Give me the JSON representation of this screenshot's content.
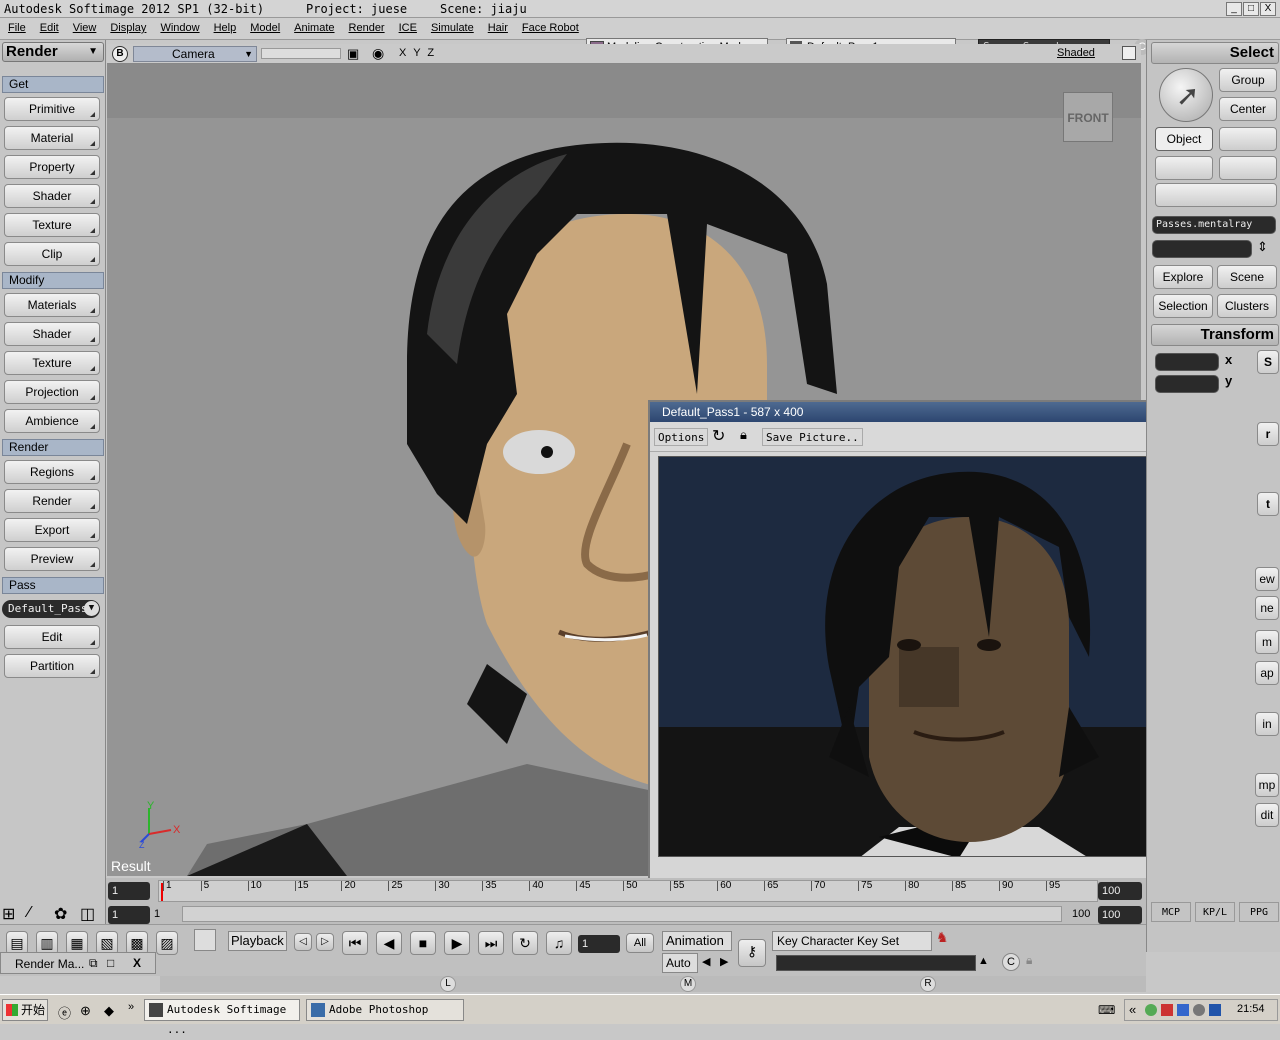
{
  "title_bar": {
    "app_title": "Autodesk Softimage 2012 SP1 (32-bit)",
    "project": "Project: juese",
    "scene": "Scene: jiaju",
    "min": "_",
    "max": "□",
    "close": "X"
  },
  "menu": {
    "items": [
      "File",
      "Edit",
      "View",
      "Display",
      "Window",
      "Help",
      "Model",
      "Animate",
      "Render",
      "ICE",
      "Simulate",
      "Hair",
      "Face Robot"
    ],
    "mode_dropdown": "Modeling Construction Mode",
    "pass_dropdown": "Default_Pass1",
    "search_placeholder": "Scene Search"
  },
  "left_panel": {
    "title": "Render",
    "sections": [
      {
        "header": "Get",
        "buttons": [
          "Primitive",
          "Material",
          "Property",
          "Shader",
          "Texture",
          "Clip"
        ]
      },
      {
        "header": "Modify",
        "buttons": [
          "Materials",
          "Shader",
          "Texture",
          "Projection",
          "Ambience"
        ]
      },
      {
        "header": "Render",
        "buttons": [
          "Regions",
          "Render",
          "Export",
          "Preview"
        ]
      },
      {
        "header": "Pass",
        "buttons": [
          "Edit",
          "Partition"
        ]
      }
    ],
    "pass_select": "Default_Pass"
  },
  "viewport": {
    "badge": "B",
    "camera": "Camera",
    "axes": "X Y Z",
    "shading": "Shaded",
    "front_label": "FRONT",
    "result_label": "Result",
    "axis_y": "Y",
    "axis_x": "X",
    "axis_z": "Z"
  },
  "render_window": {
    "title": "Default_Pass1 -  587 x 400",
    "options": "Options",
    "save": "Save Picture.."
  },
  "right_panel": {
    "select_title": "Select",
    "group": "Group",
    "center": "Center",
    "object": "Object",
    "passes": "Passes.mentalray",
    "explore": "Explore",
    "scene": "Scene",
    "selection": "Selection",
    "clusters": "Clusters",
    "transform_title": "Transform",
    "x": "x",
    "y": "y",
    "s": "S",
    "r": "r",
    "t": "t",
    "partial": [
      "ew",
      "ne",
      "m",
      "ap",
      "in",
      "mp",
      "dit"
    ],
    "tabs": [
      "MCP",
      "KP/L",
      "PPG"
    ]
  },
  "timeline": {
    "start": "1",
    "ticks": [
      "1",
      "5",
      "10",
      "15",
      "20",
      "25",
      "30",
      "35",
      "40",
      "45",
      "50",
      "55",
      "60",
      "65",
      "70",
      "75",
      "80",
      "85",
      "90",
      "95"
    ],
    "end": "100",
    "range_start": "1",
    "range_start2": "1",
    "range_end": "100",
    "range_end2": "100"
  },
  "playback": {
    "label": "Playback",
    "frame": "1",
    "all": "All",
    "animation": "Animation",
    "auto": "Auto",
    "key_set": "Key Character Key Set",
    "c": "C",
    "lmr": [
      "L",
      "M",
      "R"
    ]
  },
  "render_manager": {
    "label": "Render Ma...",
    "close": "X"
  },
  "taskbar": {
    "start": "开始",
    "tasks": [
      "Autodesk Softimage ...",
      "Adobe Photoshop"
    ],
    "time": "21:54",
    "chevron": "«"
  },
  "colors": {
    "skin": "#c9a77c",
    "hair": "#141414",
    "titlebar": "#2d4670"
  }
}
